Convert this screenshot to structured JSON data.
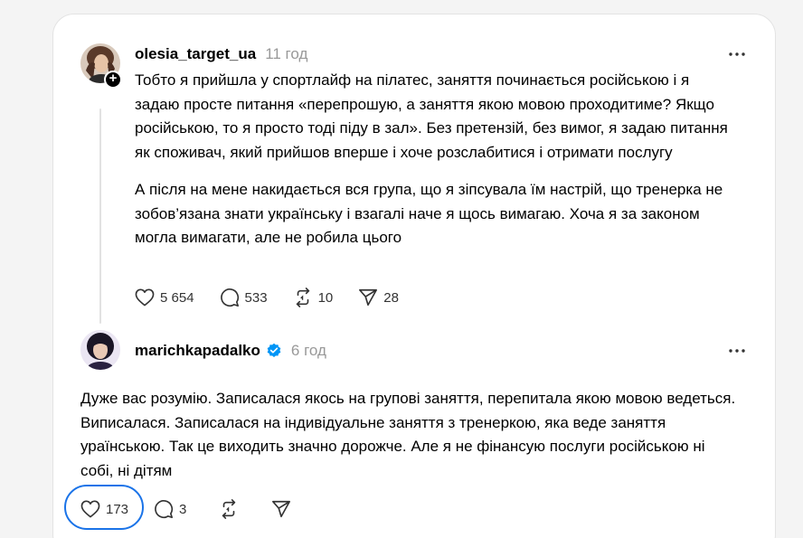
{
  "colors": {
    "background": "#f4f4f4",
    "card": "#ffffff",
    "text": "#000000",
    "muted": "#999999",
    "verified": "#0095f6",
    "focus_ring": "#1a73e8"
  },
  "posts": [
    {
      "username": "olesia_target_ua",
      "time": "11 год",
      "verified": false,
      "paragraphs": [
        "Тобто я прийшла у спортлайф на пілатес, заняття починається російською і я задаю просте питання «перепрошую, а заняття якою мовою проходитиме? Якщо російською, то я просто тоді піду в зал». Без претензій, без вимог, я задаю питання як споживач, який прийшов вперше і хоче розслабитися і отримати послугу",
        "А після на мене накидається вся група, що я зіпсувала їм настрій, що тренерка не зобов’язана знати українську і взагалі наче я щось вимагаю. Хоча я за законом могла вимагати, але не робила цього"
      ],
      "likes": "5 654",
      "replies": "533",
      "reposts": "10",
      "shares": "28"
    },
    {
      "username": "marichkapadalko",
      "time": "6 год",
      "verified": true,
      "paragraphs": [
        "Дуже вас розумію. Записалася якось на групові заняття, перепитала якою мовою ведеться. Виписалася. Записалася на індивідуальне заняття з тренеркою, яка веде заняття ураїнською. Так це виходить значно дорожче. Але я не фінансую послуги російською ні собі, ні дітям"
      ],
      "likes": "173",
      "replies": "3",
      "reposts": "",
      "shares": ""
    }
  ]
}
